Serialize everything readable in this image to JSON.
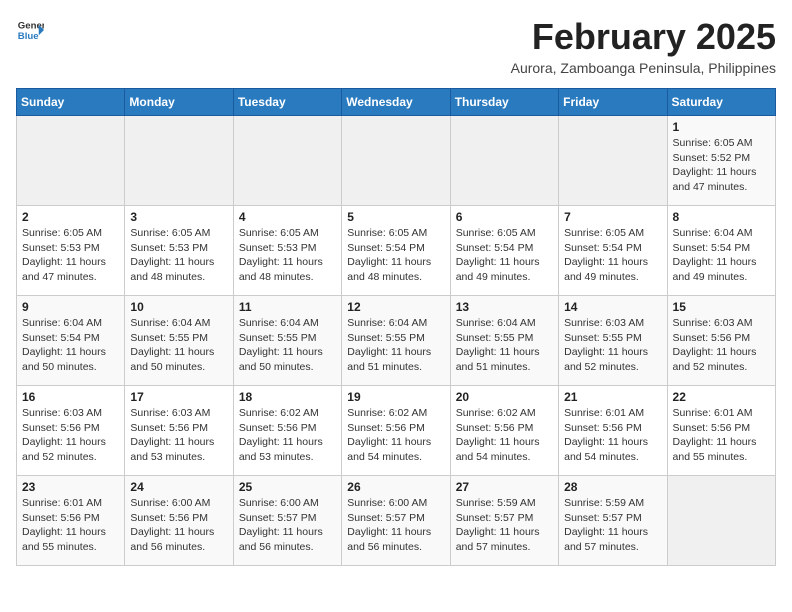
{
  "header": {
    "logo_general": "General",
    "logo_blue": "Blue",
    "month_year": "February 2025",
    "location": "Aurora, Zamboanga Peninsula, Philippines"
  },
  "days_of_week": [
    "Sunday",
    "Monday",
    "Tuesday",
    "Wednesday",
    "Thursday",
    "Friday",
    "Saturday"
  ],
  "weeks": [
    [
      {
        "day": "",
        "info": ""
      },
      {
        "day": "",
        "info": ""
      },
      {
        "day": "",
        "info": ""
      },
      {
        "day": "",
        "info": ""
      },
      {
        "day": "",
        "info": ""
      },
      {
        "day": "",
        "info": ""
      },
      {
        "day": "1",
        "info": "Sunrise: 6:05 AM\nSunset: 5:52 PM\nDaylight: 11 hours and 47 minutes."
      }
    ],
    [
      {
        "day": "2",
        "info": "Sunrise: 6:05 AM\nSunset: 5:53 PM\nDaylight: 11 hours and 47 minutes."
      },
      {
        "day": "3",
        "info": "Sunrise: 6:05 AM\nSunset: 5:53 PM\nDaylight: 11 hours and 48 minutes."
      },
      {
        "day": "4",
        "info": "Sunrise: 6:05 AM\nSunset: 5:53 PM\nDaylight: 11 hours and 48 minutes."
      },
      {
        "day": "5",
        "info": "Sunrise: 6:05 AM\nSunset: 5:54 PM\nDaylight: 11 hours and 48 minutes."
      },
      {
        "day": "6",
        "info": "Sunrise: 6:05 AM\nSunset: 5:54 PM\nDaylight: 11 hours and 49 minutes."
      },
      {
        "day": "7",
        "info": "Sunrise: 6:05 AM\nSunset: 5:54 PM\nDaylight: 11 hours and 49 minutes."
      },
      {
        "day": "8",
        "info": "Sunrise: 6:04 AM\nSunset: 5:54 PM\nDaylight: 11 hours and 49 minutes."
      }
    ],
    [
      {
        "day": "9",
        "info": "Sunrise: 6:04 AM\nSunset: 5:54 PM\nDaylight: 11 hours and 50 minutes."
      },
      {
        "day": "10",
        "info": "Sunrise: 6:04 AM\nSunset: 5:55 PM\nDaylight: 11 hours and 50 minutes."
      },
      {
        "day": "11",
        "info": "Sunrise: 6:04 AM\nSunset: 5:55 PM\nDaylight: 11 hours and 50 minutes."
      },
      {
        "day": "12",
        "info": "Sunrise: 6:04 AM\nSunset: 5:55 PM\nDaylight: 11 hours and 51 minutes."
      },
      {
        "day": "13",
        "info": "Sunrise: 6:04 AM\nSunset: 5:55 PM\nDaylight: 11 hours and 51 minutes."
      },
      {
        "day": "14",
        "info": "Sunrise: 6:03 AM\nSunset: 5:55 PM\nDaylight: 11 hours and 52 minutes."
      },
      {
        "day": "15",
        "info": "Sunrise: 6:03 AM\nSunset: 5:56 PM\nDaylight: 11 hours and 52 minutes."
      }
    ],
    [
      {
        "day": "16",
        "info": "Sunrise: 6:03 AM\nSunset: 5:56 PM\nDaylight: 11 hours and 52 minutes."
      },
      {
        "day": "17",
        "info": "Sunrise: 6:03 AM\nSunset: 5:56 PM\nDaylight: 11 hours and 53 minutes."
      },
      {
        "day": "18",
        "info": "Sunrise: 6:02 AM\nSunset: 5:56 PM\nDaylight: 11 hours and 53 minutes."
      },
      {
        "day": "19",
        "info": "Sunrise: 6:02 AM\nSunset: 5:56 PM\nDaylight: 11 hours and 54 minutes."
      },
      {
        "day": "20",
        "info": "Sunrise: 6:02 AM\nSunset: 5:56 PM\nDaylight: 11 hours and 54 minutes."
      },
      {
        "day": "21",
        "info": "Sunrise: 6:01 AM\nSunset: 5:56 PM\nDaylight: 11 hours and 54 minutes."
      },
      {
        "day": "22",
        "info": "Sunrise: 6:01 AM\nSunset: 5:56 PM\nDaylight: 11 hours and 55 minutes."
      }
    ],
    [
      {
        "day": "23",
        "info": "Sunrise: 6:01 AM\nSunset: 5:56 PM\nDaylight: 11 hours and 55 minutes."
      },
      {
        "day": "24",
        "info": "Sunrise: 6:00 AM\nSunset: 5:56 PM\nDaylight: 11 hours and 56 minutes."
      },
      {
        "day": "25",
        "info": "Sunrise: 6:00 AM\nSunset: 5:57 PM\nDaylight: 11 hours and 56 minutes."
      },
      {
        "day": "26",
        "info": "Sunrise: 6:00 AM\nSunset: 5:57 PM\nDaylight: 11 hours and 56 minutes."
      },
      {
        "day": "27",
        "info": "Sunrise: 5:59 AM\nSunset: 5:57 PM\nDaylight: 11 hours and 57 minutes."
      },
      {
        "day": "28",
        "info": "Sunrise: 5:59 AM\nSunset: 5:57 PM\nDaylight: 11 hours and 57 minutes."
      },
      {
        "day": "",
        "info": ""
      }
    ]
  ]
}
